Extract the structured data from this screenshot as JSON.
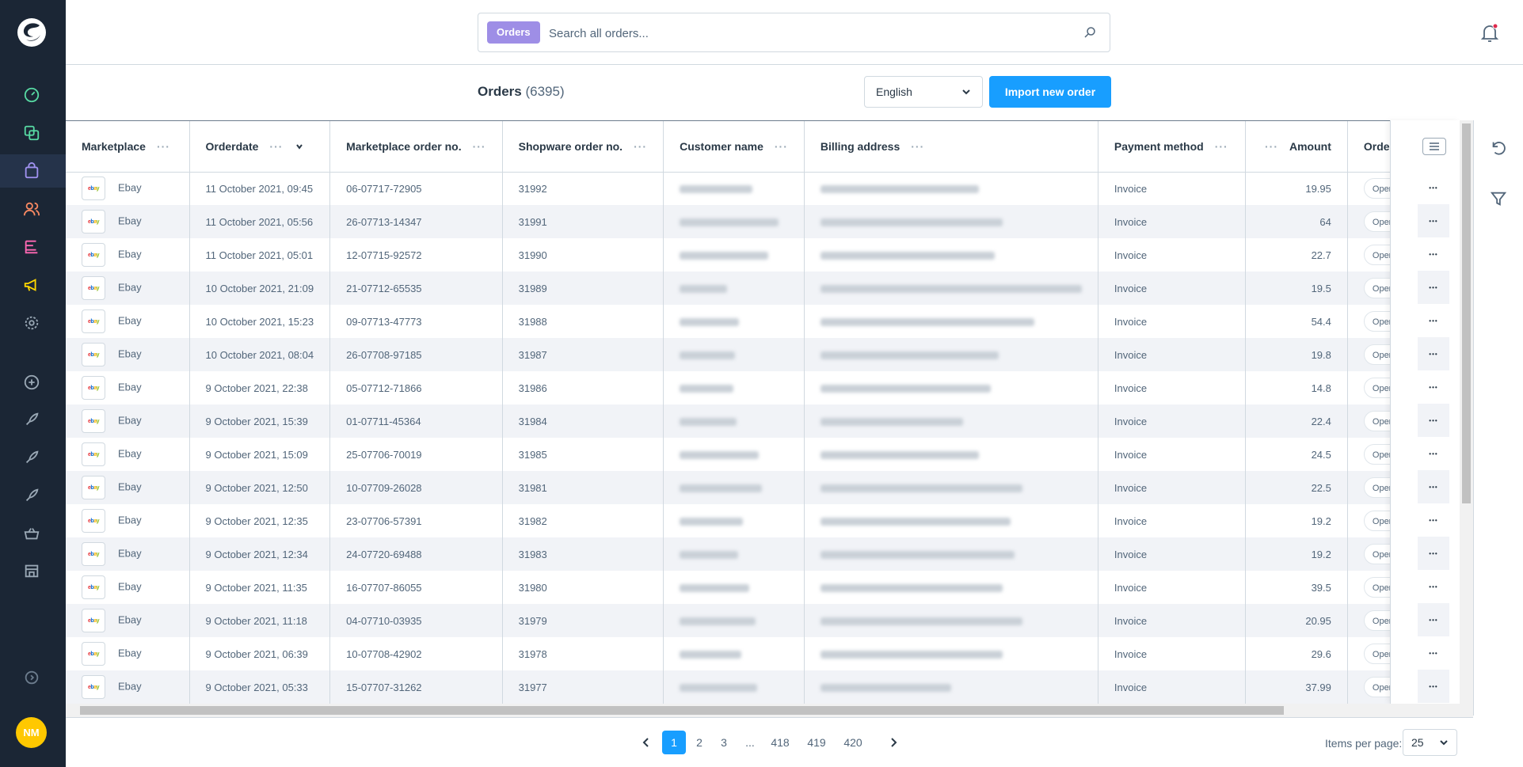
{
  "sidebar": {
    "avatar_initials": "NM",
    "items": [
      {
        "icon": "dashboard-icon",
        "color": "#57d9a3"
      },
      {
        "icon": "catalogue-icon",
        "color": "#57d9a3"
      },
      {
        "icon": "orders-icon",
        "color": "#a092f0"
      },
      {
        "icon": "customers-icon",
        "color": "#f88962"
      },
      {
        "icon": "content-icon",
        "color": "#ff68b4"
      },
      {
        "icon": "marketing-icon",
        "color": "#ffd700"
      },
      {
        "icon": "settings-icon",
        "color": "#9aa8b5"
      }
    ]
  },
  "search": {
    "tag": "Orders",
    "placeholder": "Search all orders..."
  },
  "header": {
    "title": "Orders",
    "count": "(6395)",
    "language": "English",
    "import_button": "Import new order"
  },
  "columns": [
    "Marketplace",
    "Orderdate",
    "Marketplace order no.",
    "Shopware order no.",
    "Customer name",
    "Billing address",
    "Payment method",
    "Amount",
    "Order s"
  ],
  "rows": [
    {
      "marketplace": "Ebay",
      "date": "11 October 2021, 09:45",
      "mp_no": "06-07717-72905",
      "sw_no": "31992",
      "payment": "Invoice",
      "amount": "19.95",
      "status": "Open"
    },
    {
      "marketplace": "Ebay",
      "date": "11 October 2021, 05:56",
      "mp_no": "26-07713-14347",
      "sw_no": "31991",
      "payment": "Invoice",
      "amount": "64",
      "status": "Open"
    },
    {
      "marketplace": "Ebay",
      "date": "11 October 2021, 05:01",
      "mp_no": "12-07715-92572",
      "sw_no": "31990",
      "payment": "Invoice",
      "amount": "22.7",
      "status": "Open"
    },
    {
      "marketplace": "Ebay",
      "date": "10 October 2021, 21:09",
      "mp_no": "21-07712-65535",
      "sw_no": "31989",
      "payment": "Invoice",
      "amount": "19.5",
      "status": "Open"
    },
    {
      "marketplace": "Ebay",
      "date": "10 October 2021, 15:23",
      "mp_no": "09-07713-47773",
      "sw_no": "31988",
      "payment": "Invoice",
      "amount": "54.4",
      "status": "Open"
    },
    {
      "marketplace": "Ebay",
      "date": "10 October 2021, 08:04",
      "mp_no": "26-07708-97185",
      "sw_no": "31987",
      "payment": "Invoice",
      "amount": "19.8",
      "status": "Open"
    },
    {
      "marketplace": "Ebay",
      "date": "9 October 2021, 22:38",
      "mp_no": "05-07712-71866",
      "sw_no": "31986",
      "payment": "Invoice",
      "amount": "14.8",
      "status": "Open"
    },
    {
      "marketplace": "Ebay",
      "date": "9 October 2021, 15:39",
      "mp_no": "01-07711-45364",
      "sw_no": "31984",
      "payment": "Invoice",
      "amount": "22.4",
      "status": "Open"
    },
    {
      "marketplace": "Ebay",
      "date": "9 October 2021, 15:09",
      "mp_no": "25-07706-70019",
      "sw_no": "31985",
      "payment": "Invoice",
      "amount": "24.5",
      "status": "Open"
    },
    {
      "marketplace": "Ebay",
      "date": "9 October 2021, 12:50",
      "mp_no": "10-07709-26028",
      "sw_no": "31981",
      "payment": "Invoice",
      "amount": "22.5",
      "status": "Open"
    },
    {
      "marketplace": "Ebay",
      "date": "9 October 2021, 12:35",
      "mp_no": "23-07706-57391",
      "sw_no": "31982",
      "payment": "Invoice",
      "amount": "19.2",
      "status": "Open"
    },
    {
      "marketplace": "Ebay",
      "date": "9 October 2021, 12:34",
      "mp_no": "24-07720-69488",
      "sw_no": "31983",
      "payment": "Invoice",
      "amount": "19.2",
      "status": "Open"
    },
    {
      "marketplace": "Ebay",
      "date": "9 October 2021, 11:35",
      "mp_no": "16-07707-86055",
      "sw_no": "31980",
      "payment": "Invoice",
      "amount": "39.5",
      "status": "Open"
    },
    {
      "marketplace": "Ebay",
      "date": "9 October 2021, 11:18",
      "mp_no": "04-07710-03935",
      "sw_no": "31979",
      "payment": "Invoice",
      "amount": "20.95",
      "status": "Open"
    },
    {
      "marketplace": "Ebay",
      "date": "9 October 2021, 06:39",
      "mp_no": "10-07708-42902",
      "sw_no": "31978",
      "payment": "Invoice",
      "amount": "29.6",
      "status": "Open"
    },
    {
      "marketplace": "Ebay",
      "date": "9 October 2021, 05:33",
      "mp_no": "15-07707-31262",
      "sw_no": "31977",
      "payment": "Invoice",
      "amount": "37.99",
      "status": "Open"
    }
  ],
  "pagination": {
    "pages": [
      "1",
      "2",
      "3",
      "...",
      "418",
      "419",
      "420"
    ],
    "current": "1",
    "items_per_page_label": "Items per page:",
    "items_per_page": "25"
  },
  "colors": {
    "sidebar_bg": "#1b2635",
    "primary": "#189eff",
    "search_tag": "#9e8ee6",
    "avatar": "#ffc800"
  }
}
